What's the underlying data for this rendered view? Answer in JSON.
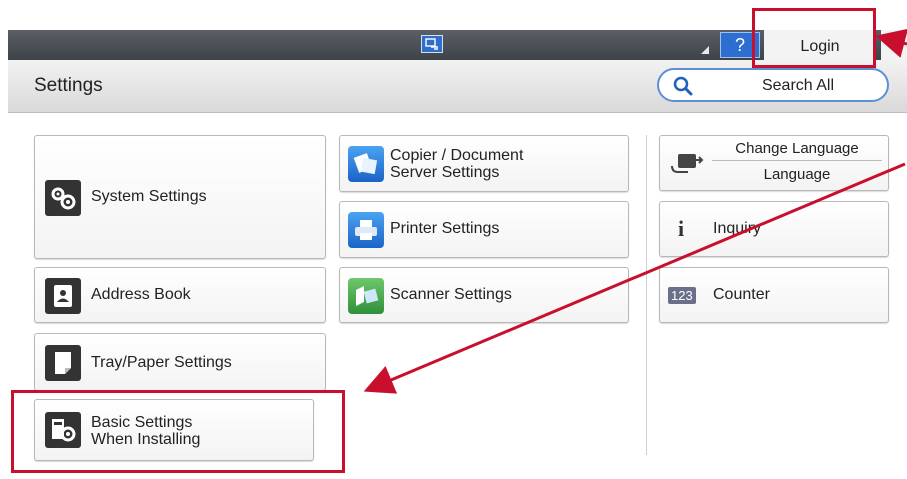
{
  "topbar": {
    "help_label": "?",
    "login_label": "Login"
  },
  "header": {
    "title": "Settings",
    "search_label": "Search All"
  },
  "tiles": {
    "system_settings": "System Settings",
    "address_book": "Address Book",
    "tray_paper": "Tray/Paper Settings",
    "basic_line1": "Basic Settings",
    "basic_line2": "When Installing",
    "copier_line1": "Copier / Document",
    "copier_line2": "Server Settings",
    "printer_settings": "Printer Settings",
    "scanner_settings": "Scanner Settings",
    "change_language": "Change Language",
    "language": "Language",
    "inquiry": "Inquiry",
    "inquiry_icon": "i",
    "counter": "Counter",
    "counter_icon": "123"
  },
  "colors": {
    "annotation": "#c8102e",
    "accent_blue": "#2d6fd1"
  }
}
